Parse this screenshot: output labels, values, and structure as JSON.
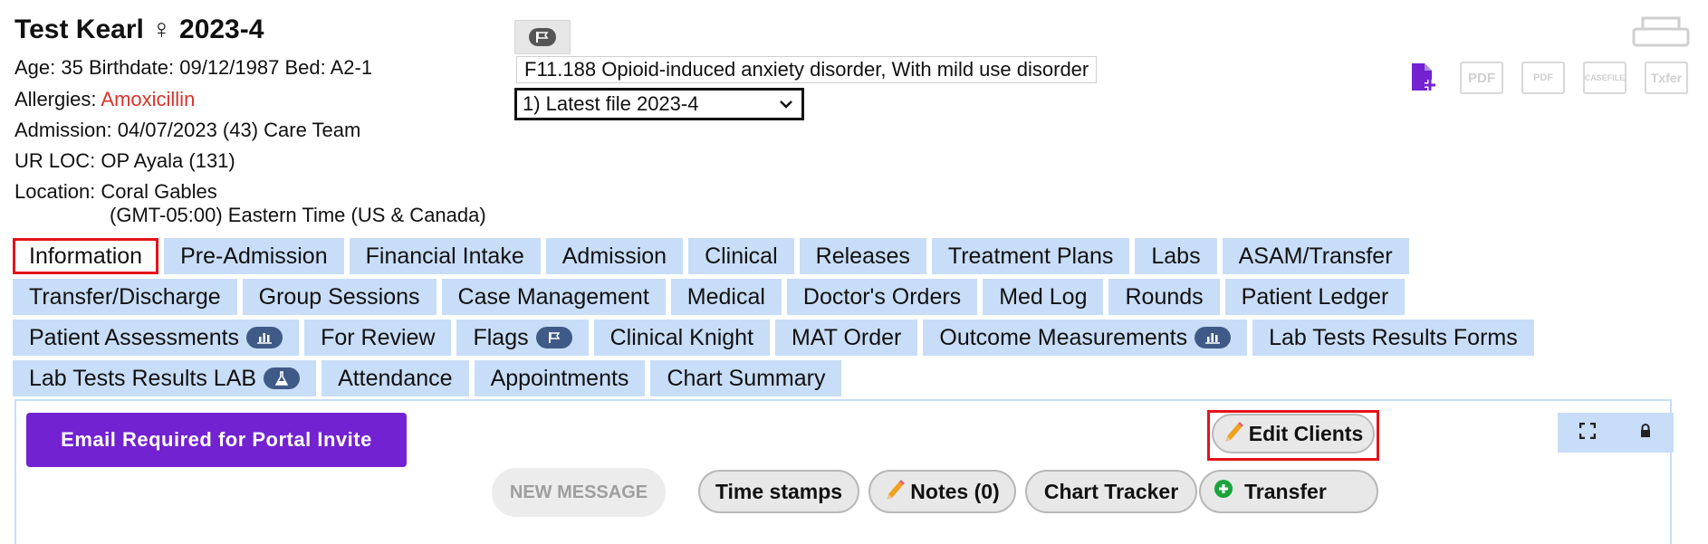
{
  "patient": {
    "name": "Test Kearl ♀ 2023-4",
    "age_line": "Age: 35   Birthdate: 09/12/1987    Bed: A2-1",
    "allergies_label": "Allergies: ",
    "allergies_value": "Amoxicillin",
    "admission_line": "Admission: 04/07/2023 (43)  Care Team",
    "ur_loc_line": "UR LOC: OP Ayala (131)",
    "location_line": "Location: Coral Gables",
    "timezone_line": "(GMT-05:00) Eastern Time (US & Canada)"
  },
  "diagnosis": "F11.188 Opioid-induced anxiety disorder, With mild use disorder",
  "file_select": {
    "selected": "1) Latest file 2023-4"
  },
  "doc_icons": [
    "PDF",
    "PDF",
    "CASEFILE",
    "Txfer"
  ],
  "tabs": {
    "row1": [
      "Information",
      "Pre-Admission",
      "Financial Intake",
      "Admission",
      "Clinical",
      "Releases",
      "Treatment Plans",
      "Labs",
      "ASAM/Transfer"
    ],
    "row2": [
      "Transfer/Discharge",
      "Group Sessions",
      "Case Management",
      "Medical",
      "Doctor's Orders",
      "Med Log",
      "Rounds",
      "Patient Ledger"
    ],
    "row3": [
      "Patient Assessments",
      "For Review",
      "Flags",
      "Clinical Knight",
      "MAT Order",
      "Outcome Measurements",
      "Lab Tests Results Forms"
    ],
    "row4": [
      "Lab Tests Results LAB",
      "Attendance",
      "Appointments",
      "Chart Summary"
    ]
  },
  "actions": {
    "portal_invite": "Email Required for Portal Invite",
    "edit_clients": "Edit Clients",
    "new_message": "NEW MESSAGE",
    "time_stamps": "Time stamps",
    "notes": "Notes (0)",
    "chart_tracker": "Chart Tracker",
    "transfer": "Transfer"
  },
  "colors": {
    "tab_bg": "#c8ddf7",
    "active_outline": "#e3131b",
    "portal_button": "#7222d1",
    "allergy_text": "#d9342b"
  }
}
